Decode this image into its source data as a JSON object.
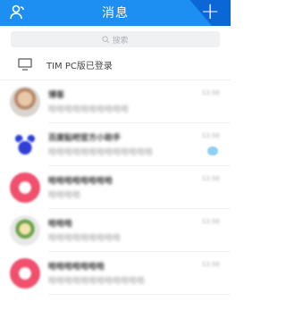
{
  "header": {
    "title": "消息"
  },
  "search": {
    "placeholder": "搜索"
  },
  "tim_pc": {
    "label": "TIM PC版已登录"
  },
  "conversations": [
    {
      "name": "博客",
      "preview": "哈哈哈哈哈哈哈哈哈哈",
      "time": "12:00",
      "avatar": "photo-boy-icon"
    },
    {
      "name": "百度贴吧官方小助手",
      "preview": "哈哈哈哈哈哈哈哈哈哈哈哈哈",
      "time": "12:00",
      "avatar": "blue-paw-icon",
      "unread": true
    },
    {
      "name": "哈哈哈哈哈哈哈哈",
      "preview": "哈哈哈哈",
      "time": "12:00",
      "avatar": "pink-circle-icon"
    },
    {
      "name": "哈哈哈",
      "preview": "哈哈哈哈哈哈哈哈哈",
      "time": "12:00",
      "avatar": "cartoon-icon"
    },
    {
      "name": "哈哈哈哈哈哈哈",
      "preview": "哈哈哈哈哈哈哈哈哈哈哈哈",
      "time": "12:00",
      "avatar": "pink-circle-icon"
    }
  ]
}
